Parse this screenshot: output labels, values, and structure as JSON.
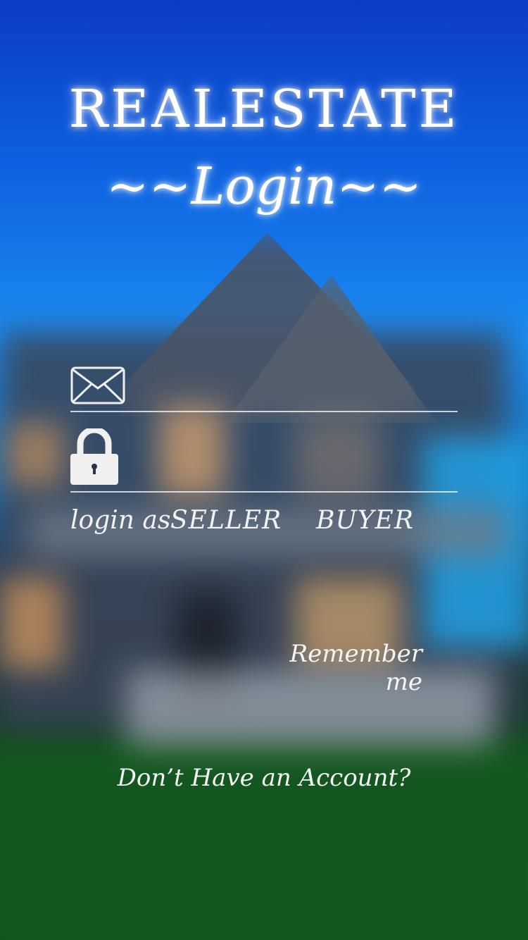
{
  "app": {
    "title": "REALESTATE",
    "subtitle": "~~Login~~"
  },
  "form": {
    "email": {
      "icon": "mail-icon",
      "value": "",
      "placeholder": ""
    },
    "password": {
      "icon": "lock-icon",
      "value": "",
      "placeholder": ""
    },
    "role": {
      "label": "login as",
      "options": [
        "SELLER",
        "BUYER"
      ]
    },
    "remember_label": "Remember me"
  },
  "signup": {
    "link_label": "Don’t Have an Account?"
  },
  "colors": {
    "text": "#ffffff",
    "underline": "#e6ebf0",
    "sky": "#0e62e0",
    "grass": "#135a1f"
  }
}
